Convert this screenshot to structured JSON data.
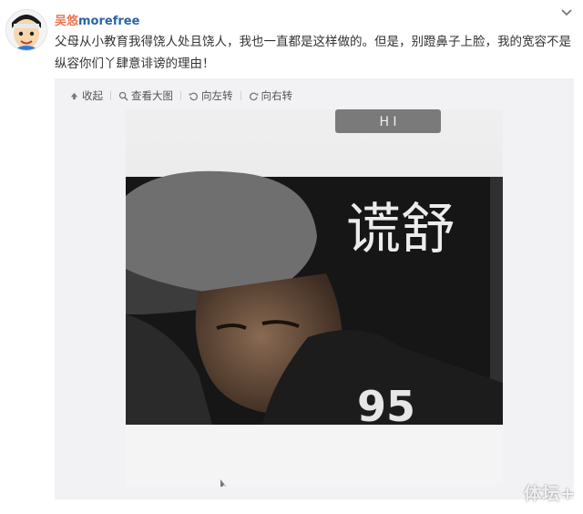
{
  "post": {
    "username_cn": "吴悠",
    "username_latin": "morefree",
    "text": "父母从小教育我得饶人处且饶人，我也一直都是这样做的。但是，别蹬鼻子上脸，我的宽容不是纵容你们丫肆意诽谤的理由！"
  },
  "toolbar": {
    "collapse": "收起",
    "view_large": "查看大图",
    "rotate_left": "向左转",
    "rotate_right": "向右转"
  },
  "photo": {
    "screen_letters": "H I",
    "jersey_number": "95",
    "calligraphy": "谎舒"
  },
  "watermark": "体坛+",
  "colors": {
    "username": "#eb7350",
    "link": "#2a63a8",
    "media_bg": "#f2f2f5"
  },
  "icons": [
    "avatar",
    "chevron-down-icon",
    "collapse-icon",
    "magnifier-icon",
    "rotate-left-icon",
    "rotate-right-icon"
  ]
}
